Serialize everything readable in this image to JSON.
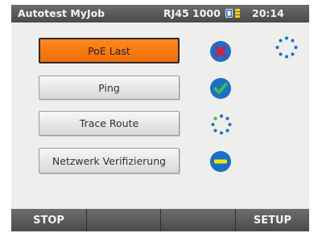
{
  "statusbar": {
    "title": "Autotest MyJob",
    "port": "RJ45 1000",
    "time": "20:14",
    "battery_icon": "battery-icon"
  },
  "tests": [
    {
      "label": "PoE Last",
      "status": "fail",
      "status_icon": "fail-x-icon",
      "active": true
    },
    {
      "label": "Ping",
      "status": "pass",
      "status_icon": "pass-check-icon"
    },
    {
      "label": "Trace Route",
      "status": "running",
      "status_icon": "loading-spinner-icon"
    },
    {
      "label": "Netzwerk Verifizierung",
      "status": "pending",
      "status_icon": "pending-dash-icon"
    }
  ],
  "overall_status_icon": "loading-spinner-icon",
  "softkeys": {
    "left": "STOP",
    "middle_left": "",
    "middle_right": "",
    "right": "SETUP"
  },
  "colors": {
    "active_orange": "#f07a10",
    "fail_red": "#e01c2a",
    "pass_green": "#3cc04a",
    "icon_blue": "#1a6fc8",
    "pending_yellow": "#f4e400",
    "battery_yellow": "#f1d400"
  }
}
